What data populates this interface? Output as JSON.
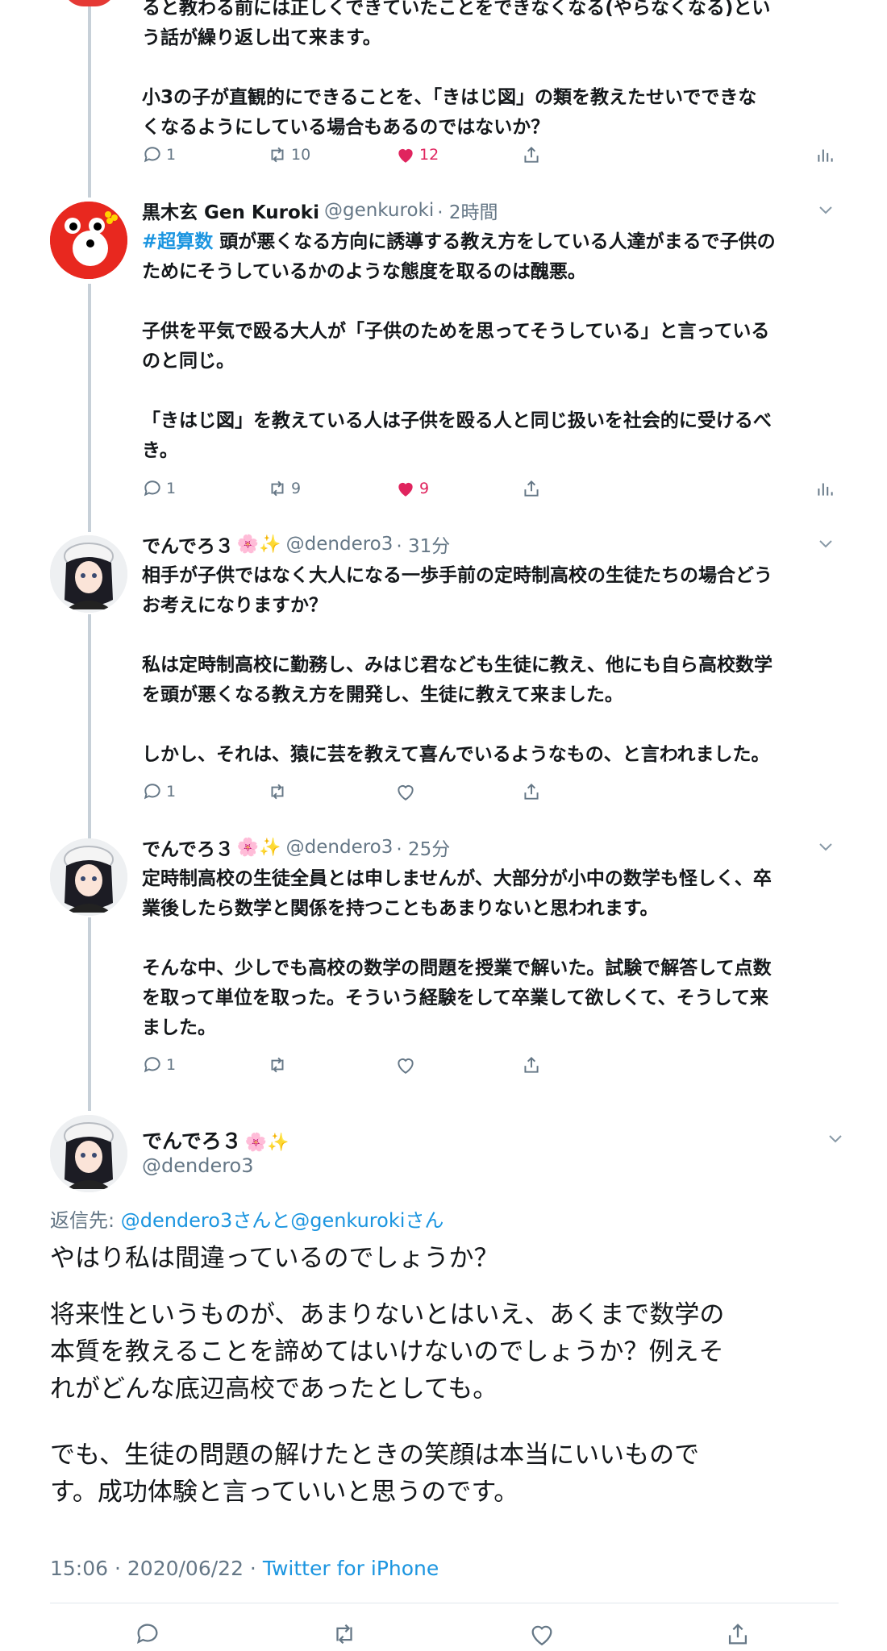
{
  "thread": [
    {
      "id": "t0",
      "text_lines": [
        "ると教わる前には正しくできていたことをできなくなる(やらなくなる)とい",
        "う話が繰り返し出て来ます。",
        "",
        "小3の子が直観的にできることを、「きはじ図」の類を教えたせいでできな",
        "くなるようにしている場合もあるのではないか？"
      ],
      "replies": "1",
      "retweets": "10",
      "likes": "12"
    },
    {
      "id": "t1",
      "name": "黒木玄 Gen Kuroki",
      "handle": "@genkuroki",
      "time": "· 2時間",
      "hashtag": "#超算数",
      "text_first": " 頭が悪くなる方向に誘導する教え方をしている人達がまるで子供の",
      "text_lines": [
        "ためにそうしているかのような態度を取るのは醜悪。",
        "",
        "子供を平気で殴る大人が「子供のためを思ってそうしている」と言っている",
        "のと同じ。",
        "",
        "「きはじ図」を教えている人は子供を殴る人と同じ扱いを社会的に受けるべ",
        "き。"
      ],
      "replies": "1",
      "retweets": "9",
      "likes": "9"
    },
    {
      "id": "t2",
      "name": "でんでろ３",
      "emoji": "🌸✨",
      "handle": "@dendero3",
      "time": "· 31分",
      "text_lines": [
        "相手が子供ではなく大人になる一歩手前の定時制高校の生徒たちの場合どう",
        "お考えになりますか？",
        "",
        "私は定時制高校に勤務し、みはじ君なども生徒に教え、他にも自ら高校数学",
        "を頭が悪くなる教え方を開発し、生徒に教えて来ました。",
        "",
        "しかし、それは、猿に芸を教えて喜んでいるようなもの、と言われました。"
      ],
      "replies": "1"
    },
    {
      "id": "t3",
      "name": "でんでろ３",
      "emoji": "🌸✨",
      "handle": "@dendero3",
      "time": "· 25分",
      "text_lines": [
        "定時制高校の生徒全員とは申しませんが、大部分が小中の数学も怪しく、卒",
        "業後したら数学と関係を持つこともあまりないと思われます。",
        "",
        "そんな中、少しでも高校の数学の問題を授業で解いた。試験で解答して点数",
        "を取って単位を取った。そういう経験をして卒業して欲しくて、そうして来",
        "ました。"
      ],
      "replies": "1"
    }
  ],
  "main_tweet": {
    "name": "でんでろ３",
    "emoji": "🌸✨",
    "handle": "@dendero3",
    "reply_label": "返信先: ",
    "reply_targets": "@dendero3さんと@genkurokiさん",
    "paragraphs": [
      "やはり私は間違っているのでしょうか？",
      "将来性というものが、あまりないとはいえ、あくまで数学の\n本質を教えることを諦めてはいけないのでしょうか？例えそ\nれがどんな底辺高校であったとしても。",
      "でも、生徒の問題の解けたときの笑顔は本当にいいもので\nす。成功体験と言っていいと思うのです。"
    ],
    "timestamp": "15:06 · 2020/06/22 · ",
    "source": "Twitter for iPhone"
  },
  "colors": {
    "accent": "#1b95e0",
    "like": "#e0245e",
    "muted": "#657786",
    "thread_line": "#c7d0d8"
  },
  "icons": [
    "reply-icon",
    "retweet-icon",
    "like-icon",
    "share-icon",
    "analytics-icon",
    "chevron-down-icon"
  ]
}
